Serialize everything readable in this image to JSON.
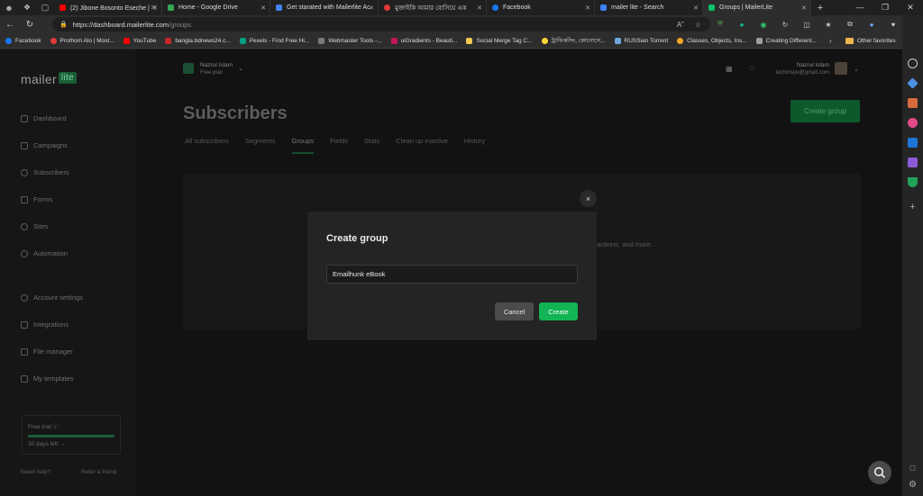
{
  "browser": {
    "tabs": [
      {
        "title": "(2) Jibone Bosonto Eseche | স",
        "color": "#ff0000"
      },
      {
        "title": "Home - Google Drive",
        "color": "#34a853"
      },
      {
        "title": "Get starated with Mailerlite Ac",
        "color": "#4285f4"
      },
      {
        "title": "মুক্তাইকি আমার বোসিয়ে এক",
        "color": "#e53935"
      },
      {
        "title": "Facebook",
        "color": "#1877f2"
      },
      {
        "title": "mailer lite - Search",
        "color": "#3b82f6"
      },
      {
        "title": "Groups | MailerLite",
        "color": "#09c269"
      }
    ],
    "url_host": "https://dashboard.mailerlite.com",
    "url_path": "/groups",
    "bookmarks": [
      {
        "label": "Facebook",
        "color": "#1877f2"
      },
      {
        "label": "Prothom Alo | Most...",
        "color": "#e53935"
      },
      {
        "label": "YouTube",
        "color": "#ff0000"
      },
      {
        "label": "bangla.bdnews24.c...",
        "color": "#c62828"
      },
      {
        "label": "Pexels - Find Free Hi...",
        "color": "#05a081"
      },
      {
        "label": "Webmaster Tools -...",
        "color": "#7a7a7a"
      },
      {
        "label": "uiGradients - Beauti...",
        "color": "#c2185b"
      },
      {
        "label": "Social Merge Tag C...",
        "color": "#f2c94c"
      },
      {
        "label": "ট্রাফিকসিং, কোনোসে...",
        "color": "#fdd835"
      },
      {
        "label": "RUSSian Torrent",
        "color": "#6fa8dc"
      },
      {
        "label": "Classes, Objects, Ins...",
        "color": "#f9a825"
      },
      {
        "label": "Creating Different...",
        "color": "#9e9e9e"
      }
    ],
    "other_favorites": "Other favorites"
  },
  "sidebar": {
    "logo_main": "mailer",
    "logo_badge": "lite",
    "items": [
      {
        "label": "Dashboard"
      },
      {
        "label": "Campaigns"
      },
      {
        "label": "Subscribers"
      },
      {
        "label": "Forms"
      },
      {
        "label": "Sites"
      },
      {
        "label": "Automation"
      },
      {
        "label": "Account settings"
      },
      {
        "label": "Integrations"
      },
      {
        "label": "File manager"
      },
      {
        "label": "My templates"
      }
    ],
    "trial_label": "Free trial ⓘ",
    "trial_days": "30 days left →",
    "trial_progress": 1.0,
    "need_help": "Need help?",
    "refer": "Refer a friend"
  },
  "account": {
    "name": "Nazrul Islam",
    "plan": "Free plan",
    "user_name": "Nazrul Islam",
    "user_email": "techmspe@gmail.com"
  },
  "main": {
    "title": "Subscribers",
    "create_group_button": "Create group",
    "tabs": [
      "All subscribers",
      "Segments",
      "Groups",
      "Fields",
      "Stats",
      "Clean up inactive",
      "History"
    ],
    "active_tab": "Groups",
    "card_text": ", actions, and more."
  },
  "modal": {
    "title": "Create group",
    "input_value": "Emailhunk eBook",
    "cancel_label": "Cancel",
    "create_label": "Create",
    "close_icon": "×"
  },
  "colors": {
    "brand_green": "#09c269",
    "create_button": "#12b454"
  }
}
